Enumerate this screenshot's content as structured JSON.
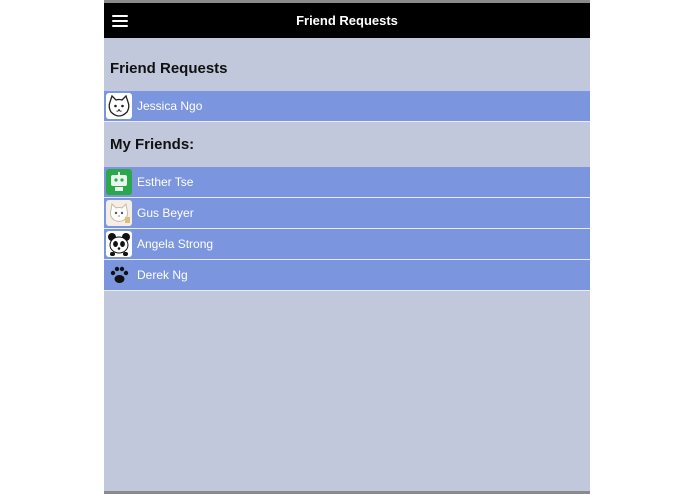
{
  "header": {
    "title": "Friend Requests",
    "menu_icon": "hamburger-menu-icon"
  },
  "requests": {
    "heading": "Friend Requests",
    "items": [
      {
        "name": "Jessica Ngo",
        "avatar": "cat-face-icon"
      }
    ]
  },
  "friends": {
    "heading": "My Friends:",
    "items": [
      {
        "name": "Esther Tse",
        "avatar": "green-robot-icon"
      },
      {
        "name": "Gus Beyer",
        "avatar": "white-cat-icon"
      },
      {
        "name": "Angela Strong",
        "avatar": "panda-icon"
      },
      {
        "name": "Derek Ng",
        "avatar": "paw-print-icon"
      }
    ]
  },
  "colors": {
    "background": "#c1c8dc",
    "row": "#7b96de",
    "topbar": "#000000"
  }
}
